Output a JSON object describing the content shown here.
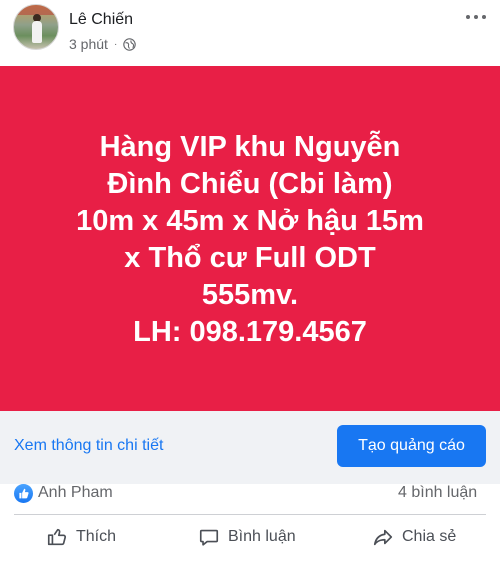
{
  "post": {
    "author": "Lê Chiến",
    "time": "3 phút",
    "separator": "·"
  },
  "banner": {
    "background": "#e81f46",
    "lines": [
      "Hàng VIP khu Nguyễn",
      "Đình Chiểu (Cbi làm)",
      "10m x 45m x Nở hậu 15m",
      "x Thổ cư Full ODT",
      "555mv.",
      "LH: 098.179.4567"
    ]
  },
  "cta": {
    "link_label": "Xem thông tin chi tiết",
    "button_label": "Tạo quảng cáo",
    "accent": "#1877f2"
  },
  "reactions": {
    "icon": "like-icon",
    "reactor_name": "Anh Pham",
    "comment_count": "4 bình luận"
  },
  "actions": {
    "like_label": "Thích",
    "comment_label": "Bình luận",
    "share_label": "Chia sẻ"
  }
}
